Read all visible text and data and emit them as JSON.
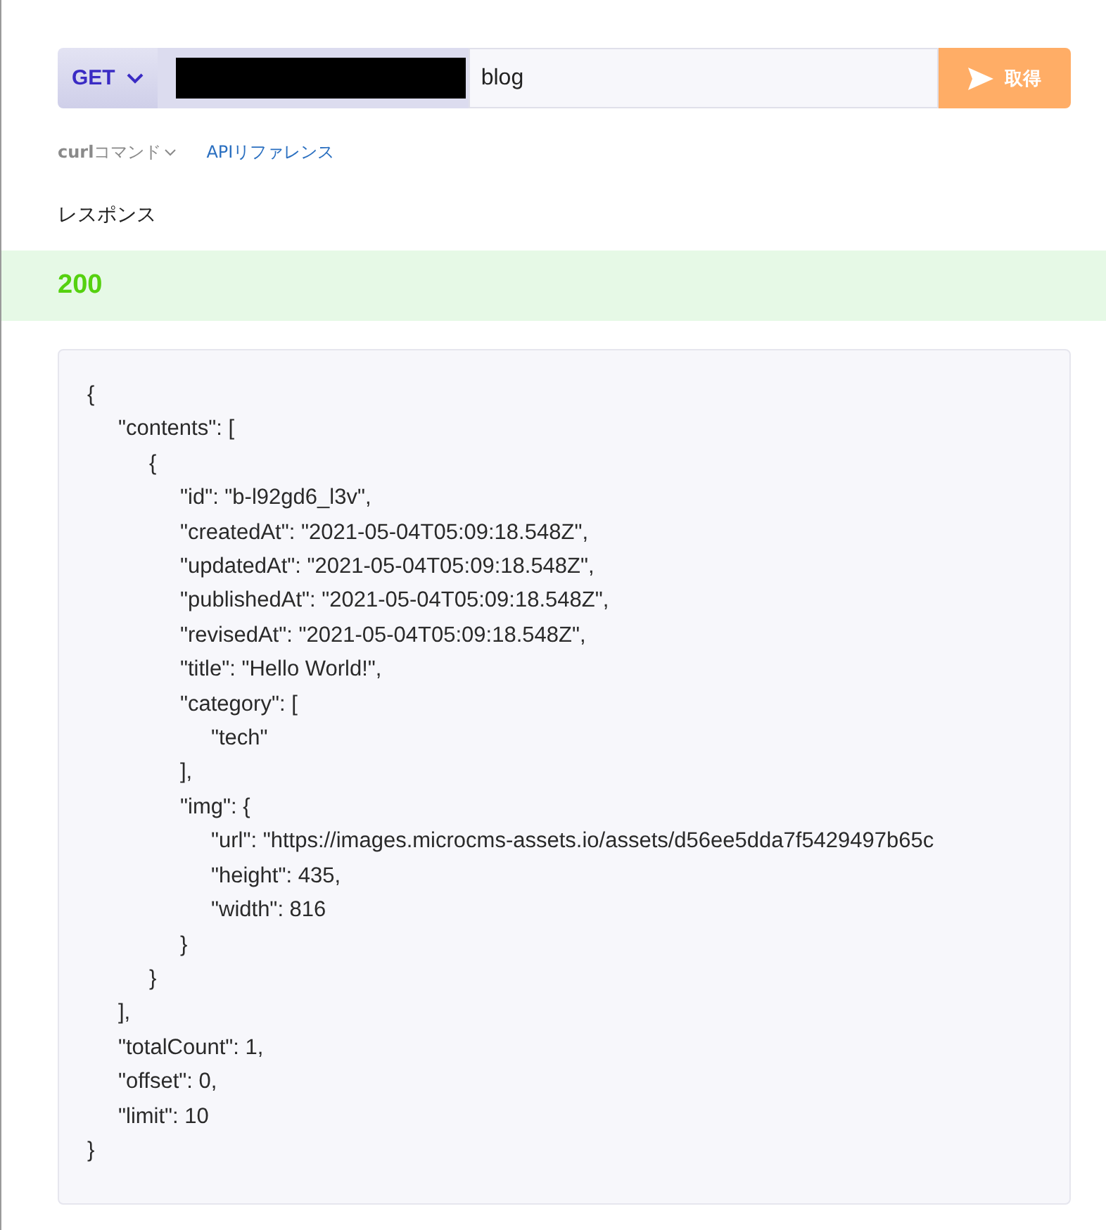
{
  "request": {
    "method": "GET",
    "endpoint": "blog",
    "submit_label": "取得"
  },
  "links": [
    {
      "kind": "toggle",
      "bold": "curl",
      "label": "コマンド"
    },
    {
      "kind": "link",
      "label": "APIリファレンス"
    }
  ],
  "response": {
    "heading": "レスポンス",
    "status": "200",
    "body": {
      "text": "{",
      "close": "}",
      "children": [
        {
          "text": "\"contents\": [",
          "close": "],",
          "children": [
            {
              "text": "{",
              "close": "}",
              "children": [
                {
                  "text": "\"id\": \"b-l92gd6_l3v\","
                },
                {
                  "text": "\"createdAt\": \"2021-05-04T05:09:18.548Z\","
                },
                {
                  "text": "\"updatedAt\": \"2021-05-04T05:09:18.548Z\","
                },
                {
                  "text": "\"publishedAt\": \"2021-05-04T05:09:18.548Z\","
                },
                {
                  "text": "\"revisedAt\": \"2021-05-04T05:09:18.548Z\","
                },
                {
                  "text": "\"title\": \"Hello World!\","
                },
                {
                  "text": "\"category\": [",
                  "close": "],",
                  "children": [
                    {
                      "text": "\"tech\""
                    }
                  ]
                },
                {
                  "text": "\"img\": {",
                  "close": "}",
                  "children": [
                    {
                      "text": "\"url\": \"https://images.microcms-assets.io/assets/d56ee5dda7f5429497b65c"
                    },
                    {
                      "text": "\"height\": 435,"
                    },
                    {
                      "text": "\"width\": 816"
                    }
                  ]
                }
              ]
            }
          ]
        },
        {
          "text": "\"totalCount\": 1,"
        },
        {
          "text": "\"offset\": 0,"
        },
        {
          "text": "\"limit\": 10"
        }
      ]
    }
  }
}
